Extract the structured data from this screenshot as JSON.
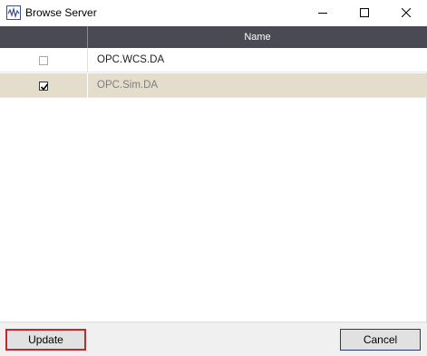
{
  "window": {
    "title": "Browse Server",
    "app_icon": "waveform-icon",
    "controls": {
      "minimize_icon": "minimize-icon",
      "maximize_icon": "maximize-icon",
      "close_icon": "close-icon"
    }
  },
  "grid": {
    "columns": [
      {
        "label": ""
      },
      {
        "label": "Name"
      }
    ],
    "rows": [
      {
        "checked": false,
        "name": "OPC.WCS.DA",
        "highlighted": false
      },
      {
        "checked": true,
        "name": "OPC.Sim.DA",
        "highlighted": true
      }
    ],
    "colors": {
      "header_bg": "#4a4a55",
      "selected_row_bg": "#e5ddcb"
    }
  },
  "footer": {
    "update_label": "Update",
    "cancel_label": "Cancel",
    "update_highlight_color": "#c1272d"
  }
}
